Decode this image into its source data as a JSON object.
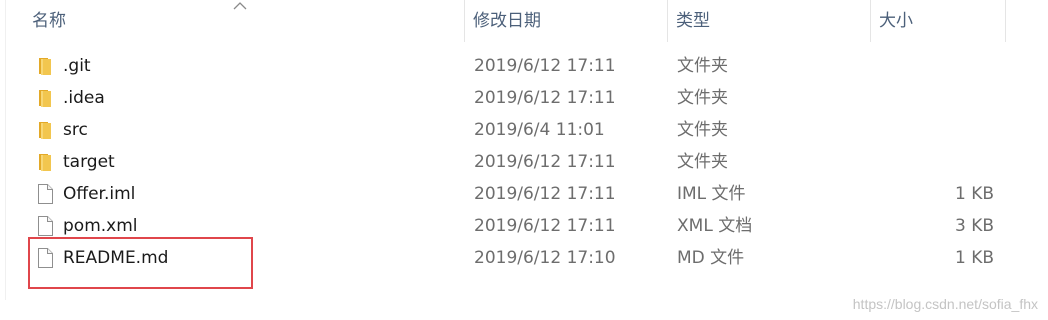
{
  "columns": {
    "name": "名称",
    "date": "修改日期",
    "type": "类型",
    "size": "大小"
  },
  "sort": {
    "column": "name",
    "direction": "ascending"
  },
  "files": [
    {
      "name": ".git",
      "date": "2019/6/12 17:11",
      "type": "文件夹",
      "size": "",
      "icon": "folder-icon"
    },
    {
      "name": ".idea",
      "date": "2019/6/12 17:11",
      "type": "文件夹",
      "size": "",
      "icon": "folder-icon"
    },
    {
      "name": "src",
      "date": "2019/6/4 11:01",
      "type": "文件夹",
      "size": "",
      "icon": "folder-icon"
    },
    {
      "name": "target",
      "date": "2019/6/12 17:11",
      "type": "文件夹",
      "size": "",
      "icon": "folder-icon"
    },
    {
      "name": "Offer.iml",
      "date": "2019/6/12 17:11",
      "type": "IML 文件",
      "size": "1 KB",
      "icon": "file-icon"
    },
    {
      "name": "pom.xml",
      "date": "2019/6/12 17:11",
      "type": "XML 文档",
      "size": "3 KB",
      "icon": "file-icon"
    },
    {
      "name": "README.md",
      "date": "2019/6/12 17:10",
      "type": "MD 文件",
      "size": "1 KB",
      "icon": "file-icon"
    }
  ],
  "highlighted_file": "README.md",
  "colors": {
    "highlight_border": "#e0464b",
    "folder": "#f2c64f",
    "header_text": "#4c607a"
  },
  "watermark": "https://blog.csdn.net/sofia_fhx"
}
